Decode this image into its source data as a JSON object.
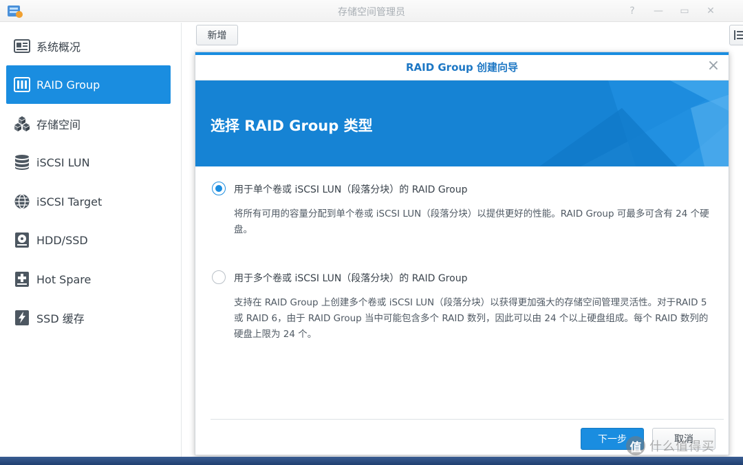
{
  "window": {
    "title": "存储空间管理员",
    "buttons": [
      "?",
      "—",
      "▭",
      "✕"
    ]
  },
  "sidebar": {
    "items": [
      {
        "label": "系统概况",
        "icon": "overview-icon"
      },
      {
        "label": "RAID Group",
        "icon": "raid-group-icon"
      },
      {
        "label": "存储空间",
        "icon": "storage-cubes-icon"
      },
      {
        "label": "iSCSI LUN",
        "icon": "database-icon"
      },
      {
        "label": "iSCSI Target",
        "icon": "globe-icon"
      },
      {
        "label": "HDD/SSD",
        "icon": "hdd-icon"
      },
      {
        "label": "Hot Spare",
        "icon": "plus-disk-icon"
      },
      {
        "label": "SSD 缓存",
        "icon": "ssd-cache-icon"
      }
    ],
    "active_index": 1
  },
  "toolbar": {
    "add_label": "新增"
  },
  "dialog": {
    "title": "RAID Group 创建向导",
    "banner_title": "选择 RAID Group 类型",
    "options": [
      {
        "label": "用于单个卷或 iSCSI LUN（段落分块）的 RAID Group",
        "description": "将所有可用的容量分配到单个卷或 iSCSI LUN（段落分块）以提供更好的性能。RAID Group 可最多可含有 24 个硬盘。",
        "selected": true
      },
      {
        "label": "用于多个卷或 iSCSI LUN（段落分块）的 RAID Group",
        "description": "支持在 RAID Group 上创建多个卷或 iSCSI LUN（段落分块）以获得更加强大的存储空间管理灵活性。对于RAID 5 或 RAID 6，由于 RAID Group 当中可能包含多个 RAID 数列，因此可以由 24 个以上硬盘组成。每个 RAID 数列的硬盘上限为 24 个。",
        "selected": false
      }
    ],
    "next_label": "下一步",
    "cancel_label": "取消"
  },
  "watermark": {
    "logo": "值",
    "text": "什么值得买"
  },
  "colors": {
    "accent": "#1a8de0",
    "title_blue": "#1d77c4",
    "banner": "#1683d4"
  }
}
